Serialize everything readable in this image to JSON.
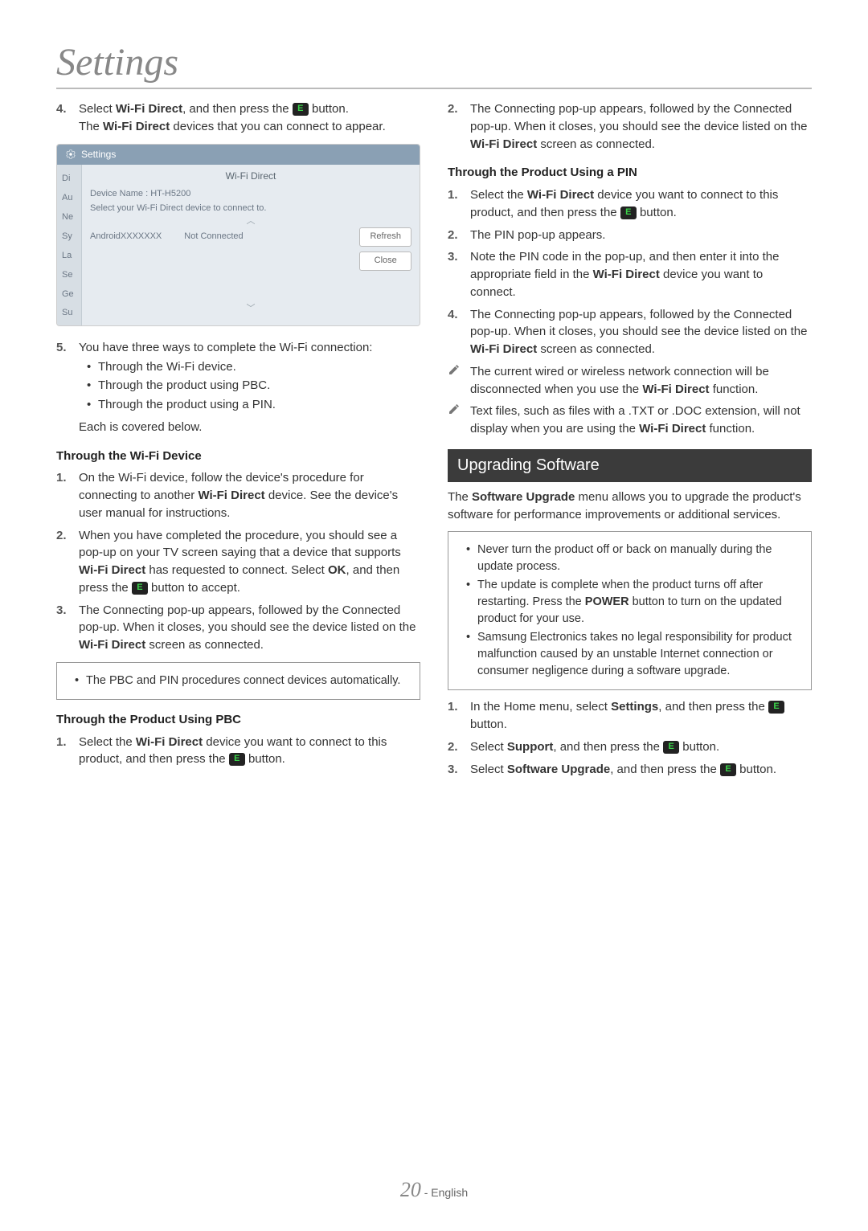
{
  "pageTitle": "Settings",
  "left": {
    "step4": {
      "num": "4.",
      "a": "Select ",
      "b": "Wi-Fi Direct",
      "c": ", and then press the ",
      "d": " button.",
      "e": "The ",
      "f": "Wi-Fi Direct",
      "g": " devices that you can connect to appear."
    },
    "shot": {
      "title": "Settings",
      "popupTitle": "Wi-Fi Direct",
      "deviceName": "Device Name : HT-H5200",
      "hint": "Select your Wi-Fi Direct device to connect to.",
      "devName": "AndroidXXXXXXX",
      "devStatus": "Not Connected",
      "refresh": "Refresh",
      "close": "Close",
      "side": [
        "Di",
        "Au",
        "Ne",
        "Sy",
        "La",
        "Se",
        "Ge",
        "Su"
      ]
    },
    "step5": {
      "num": "5.",
      "lead": "You have three ways to complete the Wi-Fi connection:",
      "b1": "Through the Wi-Fi device.",
      "b2": "Through the product using PBC.",
      "b3": "Through the product using a PIN.",
      "tail": "Each is covered below."
    },
    "h_wifi": "Through the Wi-Fi Device",
    "wifi1": {
      "num": "1.",
      "a": "On the Wi-Fi device, follow the device's procedure for connecting to another ",
      "b": "Wi-Fi Direct",
      "c": " device. See the device's user manual for instructions."
    },
    "wifi2": {
      "num": "2.",
      "a": "When you have completed the procedure, you should see a pop-up on your TV screen saying that a device that supports ",
      "b": "Wi-Fi Direct",
      "c": " has requested to connect. Select ",
      "d": "OK",
      "e": ", and then press the ",
      "f": " button to accept."
    },
    "wifi3": {
      "num": "3.",
      "a": "The Connecting pop-up appears, followed by the Connected pop-up. When it closes, you should see the device listed on the ",
      "b": "Wi-Fi Direct",
      "c": " screen as connected."
    },
    "callout": "The PBC and PIN procedures connect devices automatically.",
    "h_pbc": "Through the Product Using PBC",
    "pbc1": {
      "num": "1.",
      "a": "Select the ",
      "b": "Wi-Fi Direct",
      "c": " device you want to connect to this product, and then press the ",
      "d": " button."
    }
  },
  "right": {
    "pbc2": {
      "num": "2.",
      "a": "The Connecting pop-up appears, followed by the Connected pop-up. When it closes, you should see the device listed on the ",
      "b": "Wi-Fi Direct",
      "c": " screen as connected."
    },
    "h_pin": "Through the Product Using a PIN",
    "pin1": {
      "num": "1.",
      "a": "Select the ",
      "b": "Wi-Fi Direct",
      "c": " device you want to connect to this product, and then press the ",
      "d": " button."
    },
    "pin2": {
      "num": "2.",
      "t": "The PIN pop-up appears."
    },
    "pin3": {
      "num": "3.",
      "a": "Note the PIN code in the pop-up, and then enter it into the appropriate field in the ",
      "b": "Wi-Fi Direct",
      "c": " device you want to connect."
    },
    "pin4": {
      "num": "4.",
      "a": "The Connecting pop-up appears, followed by the Connected pop-up. When it closes, you should see the device listed on the ",
      "b": "Wi-Fi Direct",
      "c": " screen as connected."
    },
    "note1": {
      "a": "The current wired or wireless network connection will be disconnected when you use the ",
      "b": "Wi-Fi Direct",
      "c": " function."
    },
    "note2": {
      "a": "Text files, such as files with a .TXT or .DOC extension, will not display when you are using the ",
      "b": "Wi-Fi Direct",
      "c": " function."
    },
    "sectionBar": "Upgrading Software",
    "intro": {
      "a": "The ",
      "b": "Software Upgrade",
      "c": " menu allows you to upgrade the product's software for performance improvements or additional services."
    },
    "callout": {
      "b1": "Never turn the product off or back on manually during the update process.",
      "b2a": "The update is complete when the product turns off after restarting. Press the ",
      "b2b": "POWER",
      "b2c": " button to turn on the updated product for your use.",
      "b3": "Samsung Electronics takes no legal responsibility for product malfunction caused by an unstable Internet connection or consumer negligence during a software upgrade."
    },
    "sw1": {
      "num": "1.",
      "a": "In the Home menu, select ",
      "b": "Settings",
      "c": ", and then press the ",
      "d": " button."
    },
    "sw2": {
      "num": "2.",
      "a": "Select ",
      "b": "Support",
      "c": ", and then press the ",
      "d": " button."
    },
    "sw3": {
      "num": "3.",
      "a": "Select ",
      "b": "Software Upgrade",
      "c": ", and then press the ",
      "d": " button."
    }
  },
  "footer": {
    "page": "20",
    "sep": " - ",
    "lang": "English"
  },
  "enter": "E"
}
